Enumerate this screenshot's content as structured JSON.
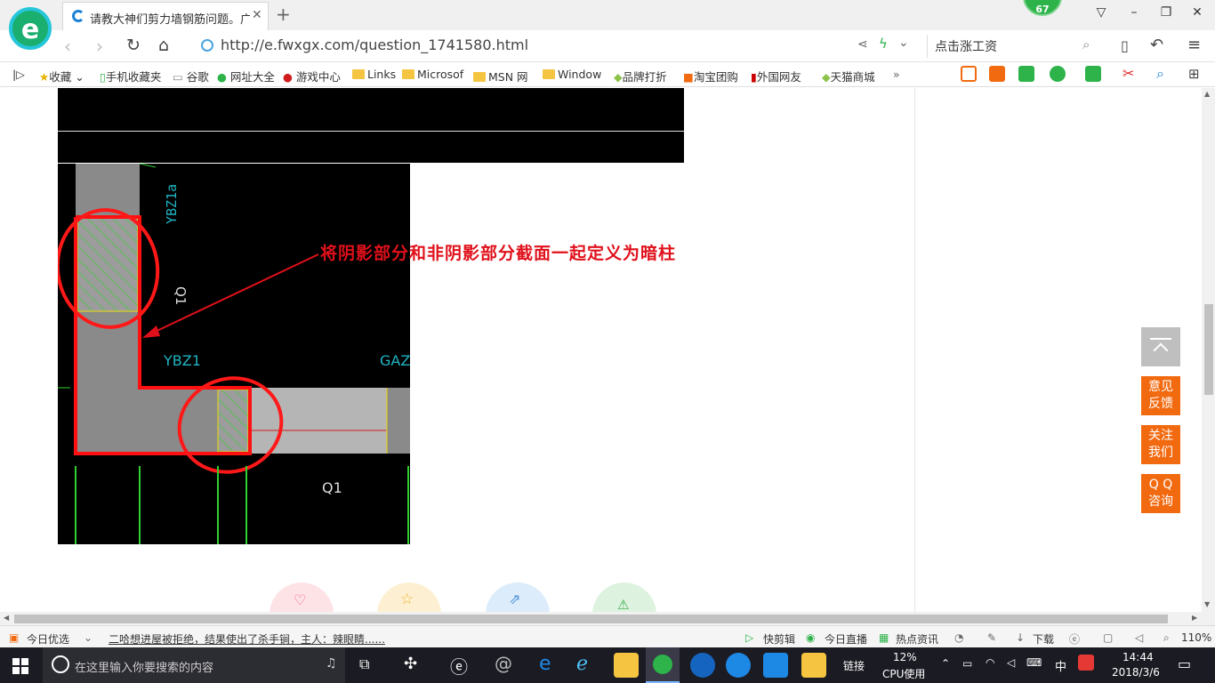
{
  "browser": {
    "tab_title": "请教大神们剪力墙钢筋问题。广",
    "badge_count": "67",
    "url": "http://e.fwxgx.com/question_1741580.html",
    "search_placeholder": "点击涨工资"
  },
  "bookmarks": [
    "收藏",
    "手机收藏夹",
    "谷歌",
    "网址大全",
    "游戏中心",
    "Links",
    "Microsof",
    "MSN 网",
    "Window",
    "品牌打折",
    "淘宝团购",
    "外国网友",
    "天猫商城"
  ],
  "content": {
    "annotation": "将阴影部分和非阴影部分截面一起定义为暗柱",
    "cad_labels": {
      "ybz1a": "YBZ1a",
      "q1_top": "Q1",
      "ybz1": "YBZ1",
      "gaz": "GAZ",
      "q1_bottom": "Q1"
    }
  },
  "side_buttons": {
    "feedback": [
      "意见",
      "反馈"
    ],
    "follow": [
      "关注",
      "我们"
    ],
    "qq": [
      "Q Q",
      "咨询"
    ]
  },
  "statusbar": {
    "today_pick": "今日优选",
    "news": "二哈想进屋被拒绝，结果使出了杀手锏，主人：辣眼睛......",
    "quick_clip": "快剪辑",
    "live": "今日直播",
    "hot_news": "热点资讯",
    "download": "下载",
    "zoom": "110%"
  },
  "taskbar": {
    "search_placeholder": "在这里输入你要搜索的内容",
    "links": "链接",
    "cpu_percent": "12%",
    "cpu_label": "CPU使用",
    "ime": "中",
    "time": "14:44",
    "date": "2018/3/6"
  },
  "colors": {
    "accent_orange": "#f26a10",
    "annotation_red": "#e0101a",
    "cad_cyan": "#1fb5c4"
  }
}
